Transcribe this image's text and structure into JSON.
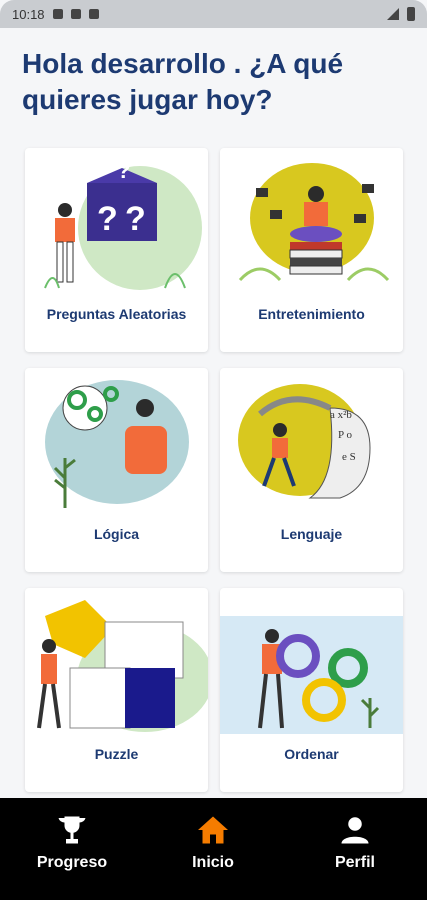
{
  "status_bar": {
    "time": "10:18"
  },
  "greeting": "Hola desarrollo . ¿A qué quieres jugar hoy?",
  "categories": [
    {
      "label": "Preguntas Aleatorias"
    },
    {
      "label": "Entretenimiento"
    },
    {
      "label": "Lógica"
    },
    {
      "label": "Lenguaje"
    },
    {
      "label": "Puzzle"
    },
    {
      "label": "Ordenar"
    }
  ],
  "nav": {
    "progress": "Progreso",
    "home": "Inicio",
    "profile": "Perfil"
  },
  "colors": {
    "title": "#1d3a72",
    "accent_orange": "#f57c00",
    "green_blob": "#cfe8c5",
    "yellow_blob": "#d8c81f",
    "teal_blob": "#b3d4d8",
    "nav_bg": "#000000"
  },
  "icons": {
    "progress": "trophy-icon",
    "home": "home-icon",
    "profile": "person-icon"
  }
}
